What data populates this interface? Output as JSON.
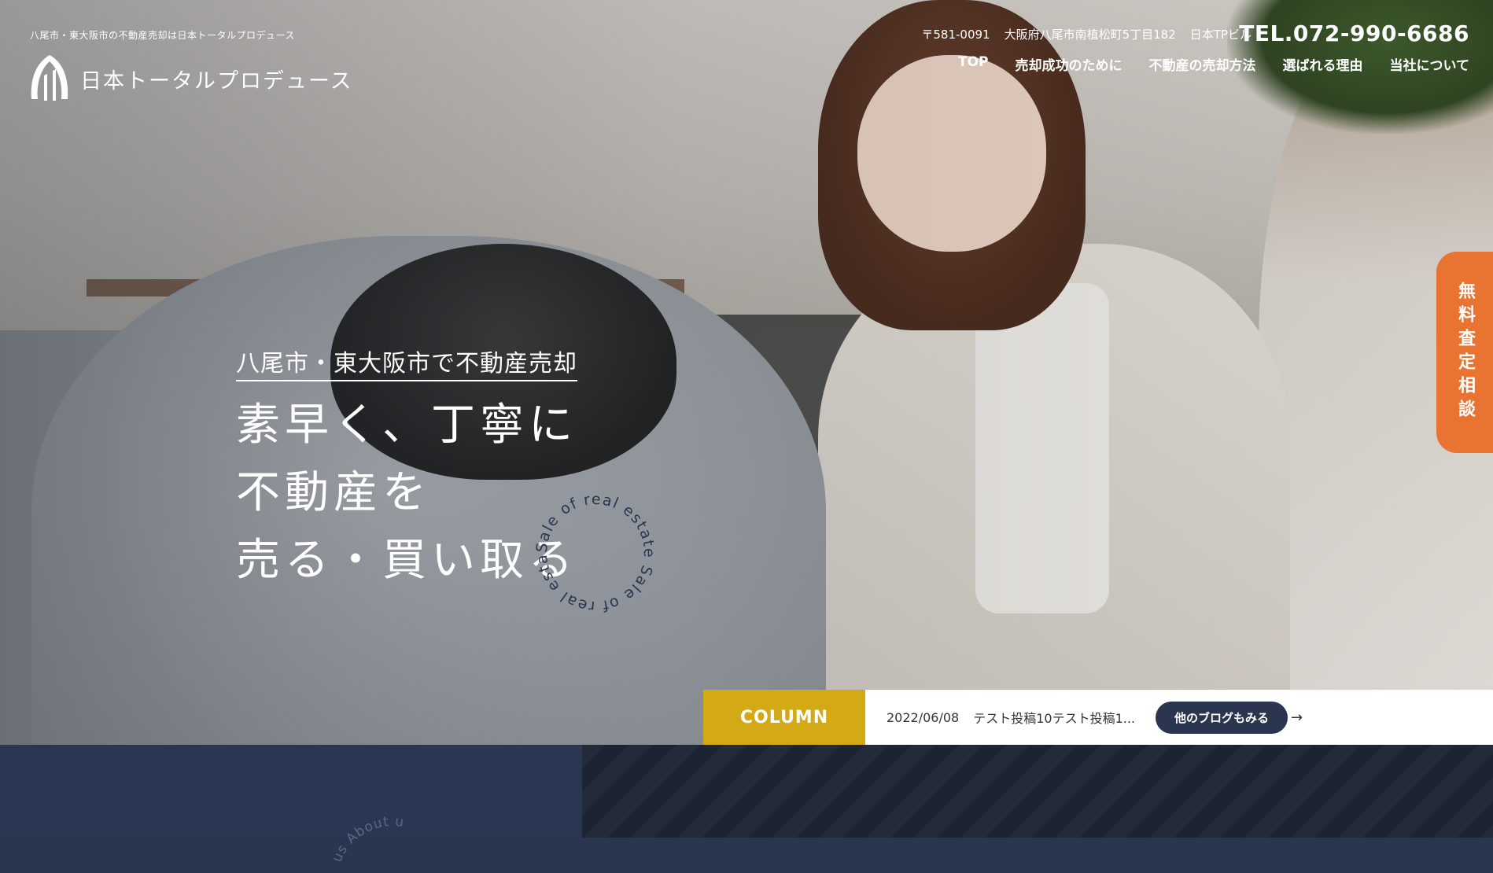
{
  "header": {
    "tagline": "八尾市・東大阪市の不動産売却は日本トータルプロデュース",
    "logo_text": "日本トータルプロデュース",
    "postal": "〒581-0091",
    "address": "大阪府八尾市南植松町5丁目182",
    "building": "日本TPビル",
    "tel": "TEL.072-990-6686"
  },
  "nav": {
    "items": [
      {
        "label": "TOP"
      },
      {
        "label": "売却成功のために"
      },
      {
        "label": "不動産の売却方法"
      },
      {
        "label": "選ばれる理由"
      },
      {
        "label": "当社について"
      }
    ]
  },
  "hero": {
    "lead": "八尾市・東大阪市で不動産売却",
    "headline": [
      "素早く、丁寧に",
      "不動産を",
      "売る・買い取る"
    ],
    "circle_text": "Sale of real estate Sale of real estate"
  },
  "side_cta": {
    "label": "無料査定相談"
  },
  "column_bar": {
    "label": "COLUMN",
    "date": "2022/06/08",
    "post_title": "テスト投稿10テスト投稿1...",
    "more_label": "他のブログもみる",
    "arrow": "→"
  },
  "about": {
    "arc_text": "us About u"
  },
  "colors": {
    "accent_orange": "#e97431",
    "column_gold": "#d3a916",
    "navy": "#2a3550",
    "dark_navy": "#1c2333"
  }
}
